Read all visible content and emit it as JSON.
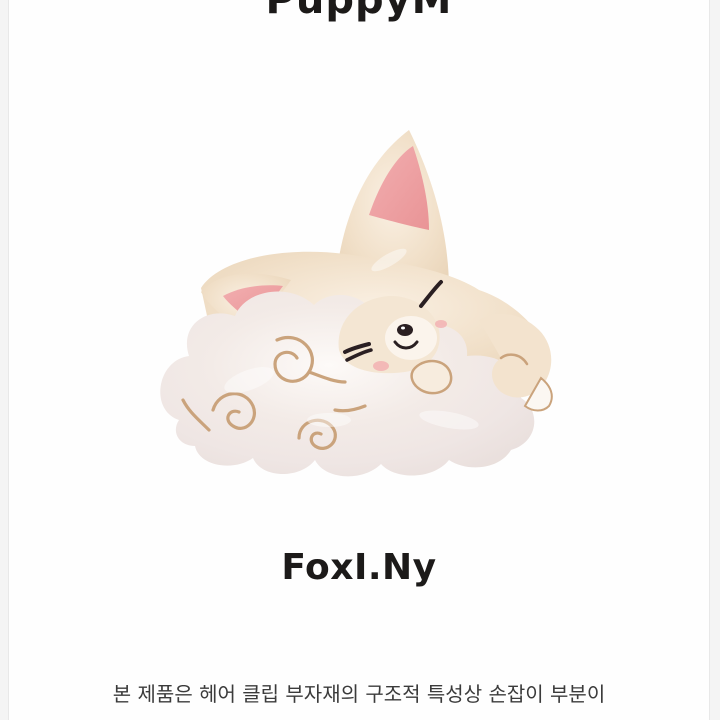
{
  "header": {
    "brand": "PuppyM"
  },
  "product": {
    "name": "FoxI.Ny",
    "illustration_icon": "sleeping-fox-on-cloud-hair-clip"
  },
  "notice": {
    "line1": "본 제품은 헤어 클립 부자재의 구조적 특성상 손잡이 부분이"
  },
  "colors": {
    "background": "#fefefe",
    "text": "#1c1a19",
    "fox_body": "#f2e3cf",
    "ear_pink": "#ee9ea0",
    "cloud_pearl": "#f6efea",
    "swirl": "#caa37c"
  }
}
